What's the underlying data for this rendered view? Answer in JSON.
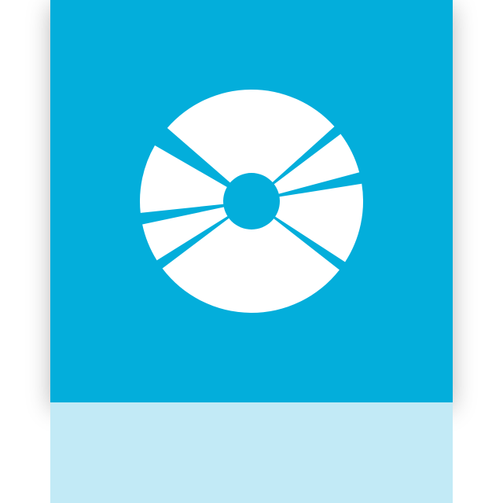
{
  "tile": {
    "icon": "optical-disc-icon",
    "background_color": "#03AEDB",
    "icon_color": "#FFFFFF"
  },
  "reflection": {
    "icon": "optical-disc-icon",
    "background_color": "#C2EAF6",
    "icon_color": "#FFFFFF"
  }
}
